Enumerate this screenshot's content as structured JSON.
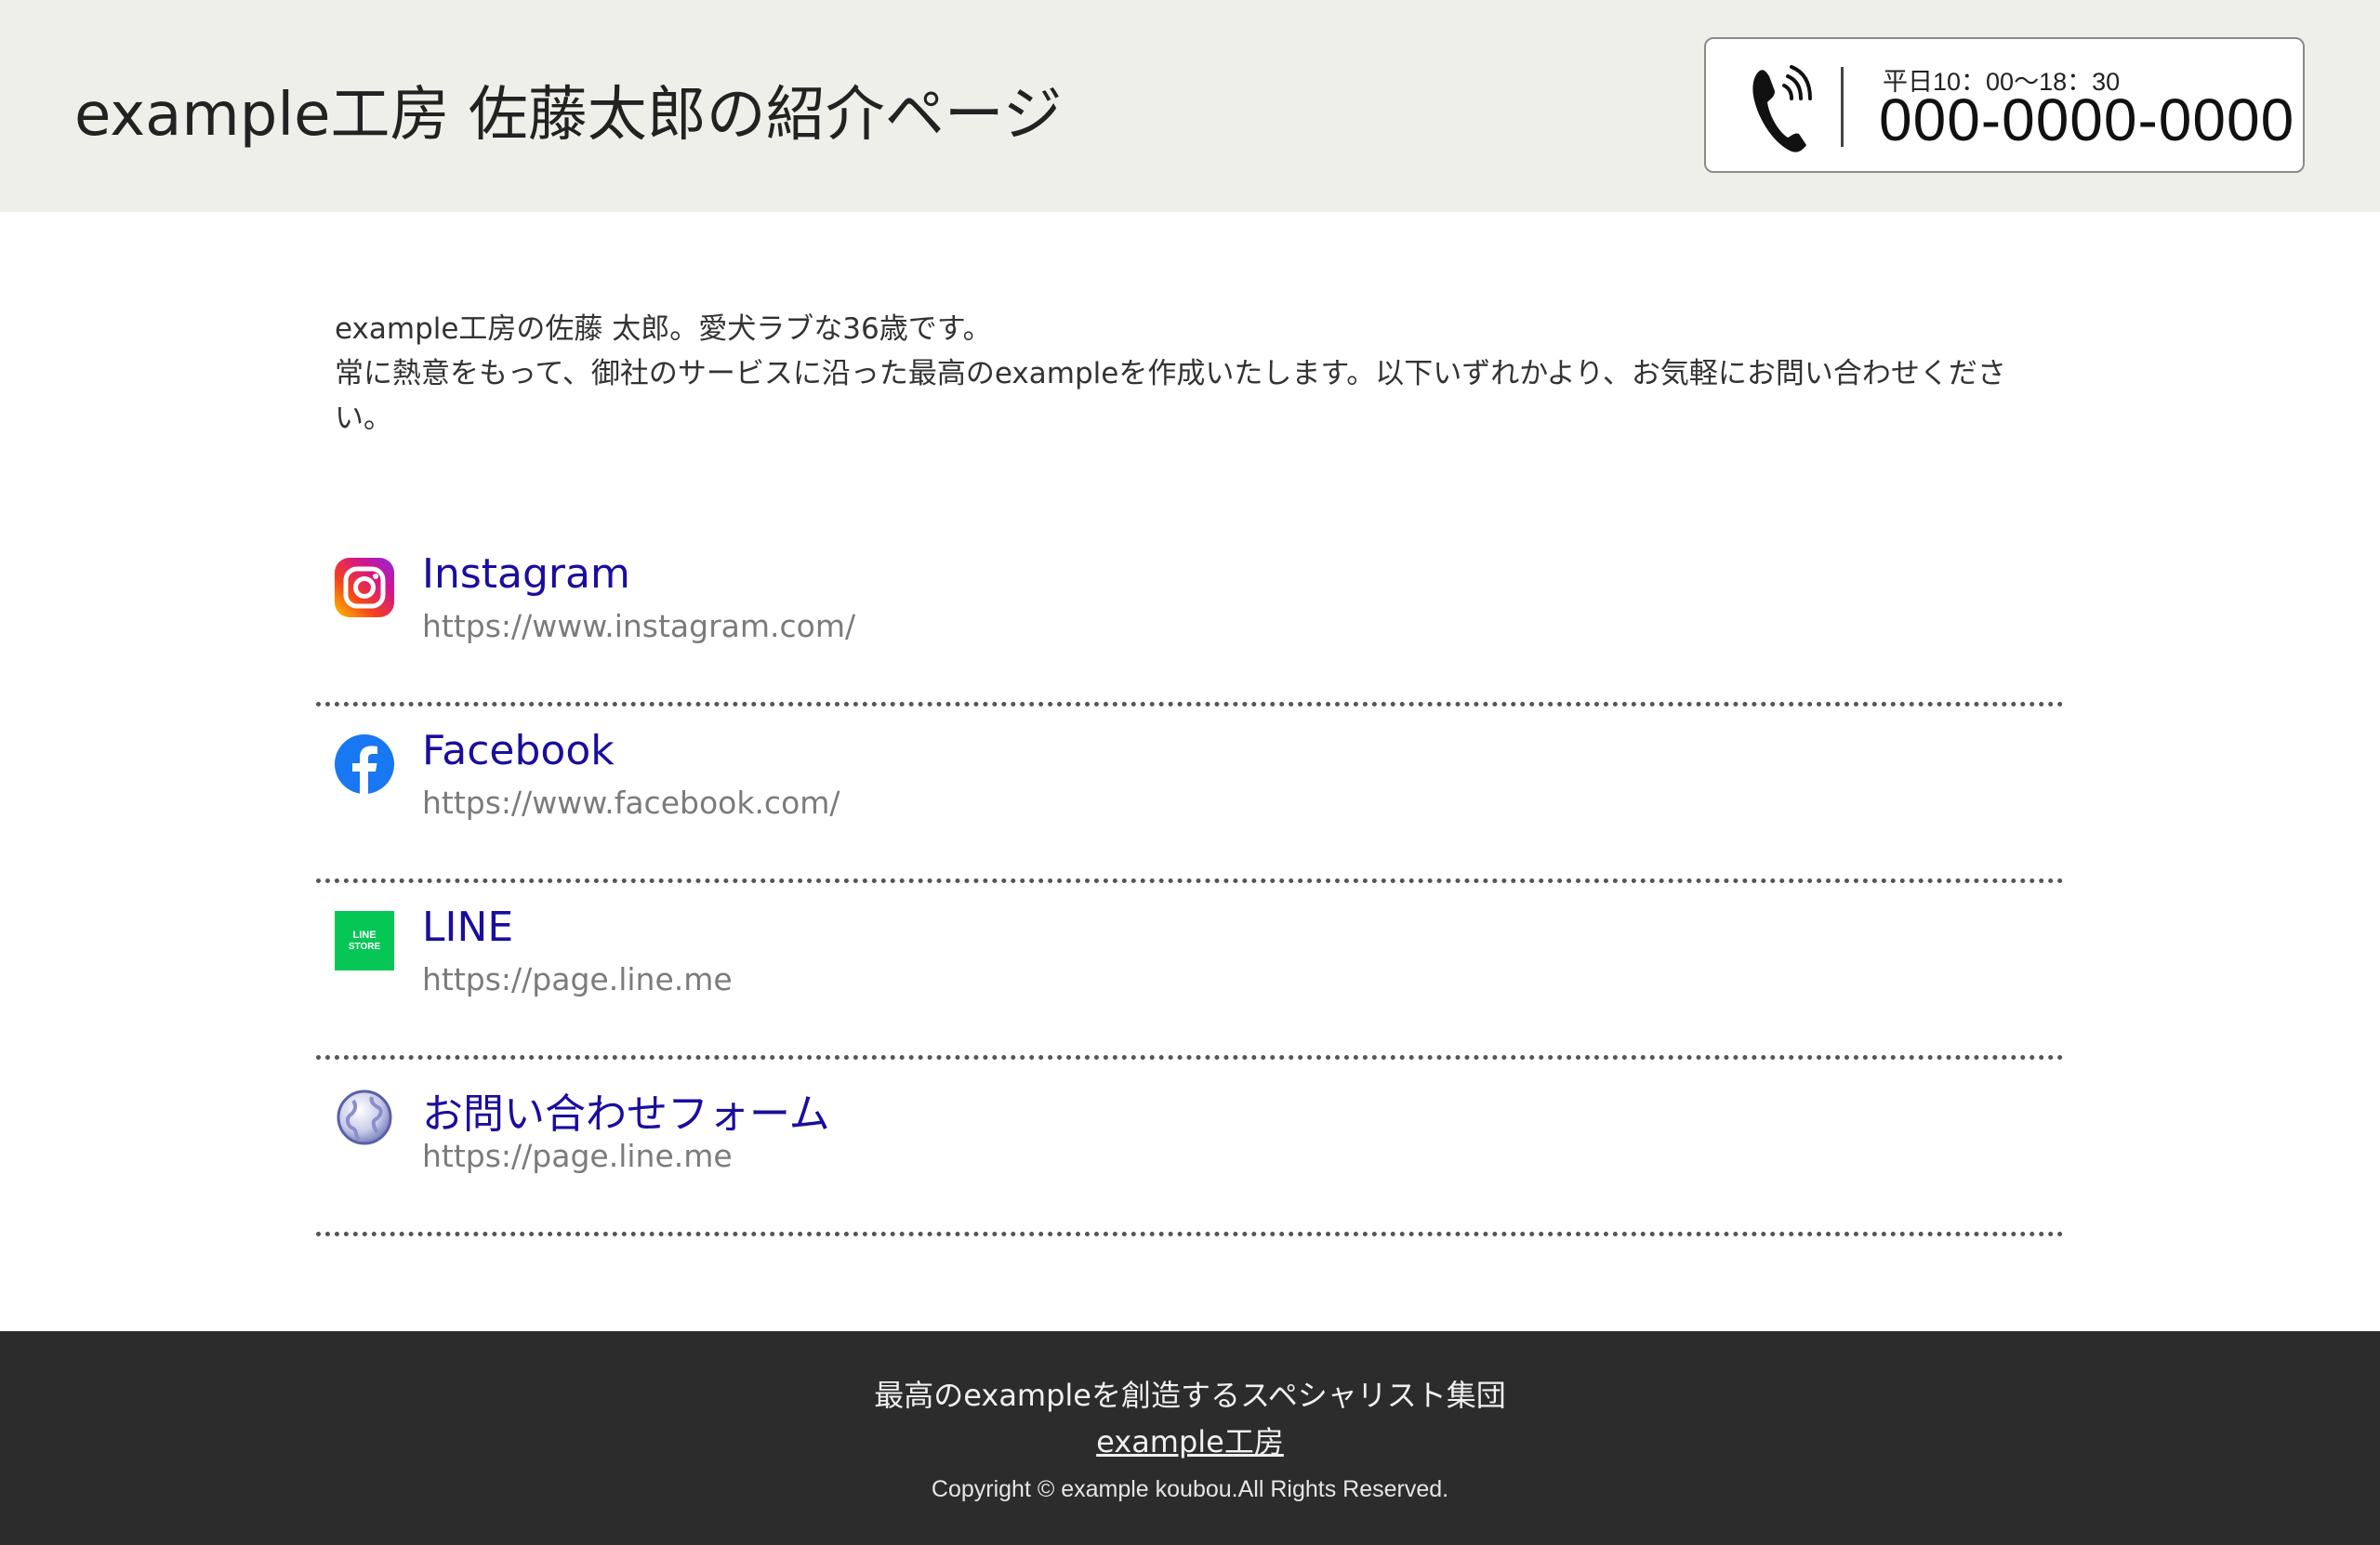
{
  "header": {
    "title": "example工房 佐藤太郎の紹介ページ",
    "phone": {
      "hours": "平日10：00〜18：30",
      "number": "000-0000-0000",
      "icon": "phone-icon"
    }
  },
  "intro": {
    "line1": "example工房の佐藤 太郎。愛犬ラブな36歳です。",
    "line2": "常に熱意をもって、御社のサービスに沿った最高のexampleを作成いたします。以下いずれかより、お気軽にお問い合わせください。"
  },
  "links": [
    {
      "title": "Instagram",
      "url": "https://www.instagram.com/",
      "icon": "instagram-icon"
    },
    {
      "title": "Facebook",
      "url": "https://www.facebook.com/",
      "icon": "facebook-icon"
    },
    {
      "title": "LINE",
      "url": "https://page.line.me",
      "icon": "line-store-icon",
      "icon_text_top": "LINE",
      "icon_text_bottom": "STORE"
    },
    {
      "title": "お問い合わせフォーム",
      "url": "https://page.line.me",
      "icon": "globe-icon"
    }
  ],
  "footer": {
    "tagline": "最高のexampleを創造するスペシャリスト集団",
    "brand": "example工房",
    "copyright": "Copyright © example koubou.All Rights Reserved."
  },
  "colors": {
    "header_bg": "#efefea",
    "link_title": "#1a0d9e",
    "link_url": "#7b7b7b",
    "footer_bg": "#2c2c2c",
    "line_green": "#06c755",
    "facebook_blue": "#1877f2"
  }
}
